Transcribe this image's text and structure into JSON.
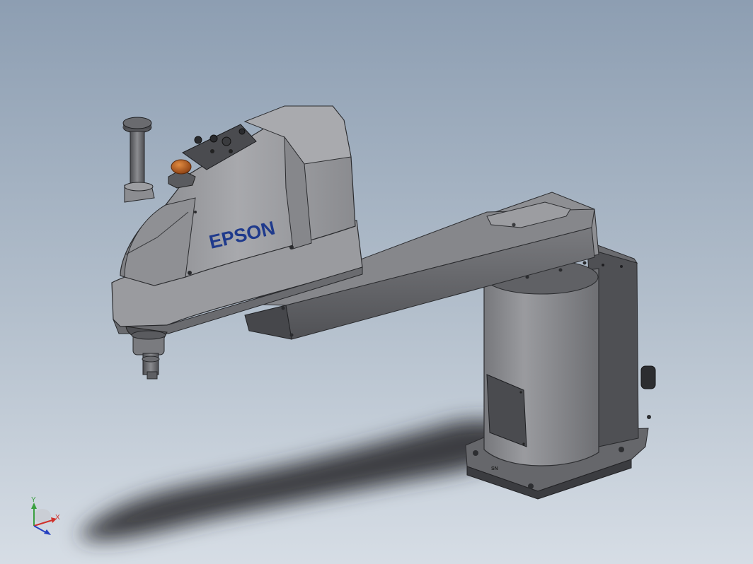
{
  "model": {
    "brand_text": "EPSON",
    "base_marking": "SN"
  },
  "triad": {
    "x_label": "X",
    "y_label": "Y"
  },
  "colors": {
    "background_top": "#8e9fb3",
    "background_bottom": "#d4dbe3",
    "body": "#9a9a9e",
    "dark_body": "#55565a",
    "brand": "#1f3a8c",
    "emergency_button": "#b25a1c",
    "axis_x": "#d0302a",
    "axis_y": "#3aa040",
    "axis_z": "#2540c0"
  }
}
